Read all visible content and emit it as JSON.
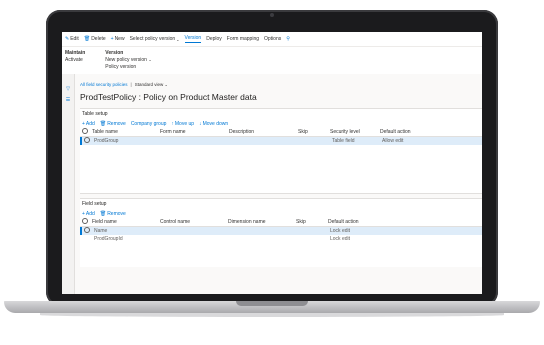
{
  "toolbar": {
    "items": [
      {
        "label": "Edit",
        "icon": "pencil-icon"
      },
      {
        "label": "Delete",
        "icon": "trash-icon"
      },
      {
        "label": "New",
        "icon": "plus-icon"
      },
      {
        "label": "Select policy version",
        "icon": "chevron-down-icon"
      },
      {
        "label": "Version"
      },
      {
        "label": "Deploy"
      },
      {
        "label": "Form mapping"
      },
      {
        "label": "Options"
      }
    ],
    "active_tab": "Version",
    "search_icon": "search-icon"
  },
  "ribbon": {
    "maintain": {
      "header": "Maintain",
      "items": [
        "Activate"
      ]
    },
    "version": {
      "header": "Version",
      "items": [
        "New policy version",
        "Policy version"
      ]
    }
  },
  "leftrail": {
    "icons": [
      "filter-icon",
      "list-icon"
    ]
  },
  "breadcrumb": {
    "link": "All field security policies",
    "separator": "|",
    "view": "Standard view"
  },
  "page_title": "ProdTestPolicy : Policy on Product Master data",
  "table_setup": {
    "title": "Table setup",
    "actions": [
      "Add",
      "Remove",
      "Company group",
      "Move up",
      "Move down"
    ],
    "columns": [
      "Table name",
      "Form name",
      "Description",
      "Skip",
      "Security level",
      "Default action"
    ],
    "rows": [
      {
        "table_name": "ProdGroup",
        "form_name": "",
        "description": "",
        "skip": "",
        "security_level": "Table field",
        "default_action": "Allow edit",
        "selected": true
      }
    ]
  },
  "field_setup": {
    "title": "Field setup",
    "actions": [
      "Add",
      "Remove"
    ],
    "columns": [
      "Field name",
      "Control name",
      "Dimension name",
      "Skip",
      "Default action"
    ],
    "rows": [
      {
        "field_name": "Name",
        "control_name": "",
        "dimension_name": "",
        "skip": "",
        "default_action": "Lock edit",
        "selected": true
      },
      {
        "field_name": "ProdGroupId",
        "control_name": "",
        "dimension_name": "",
        "skip": "",
        "default_action": "Lock edit",
        "selected": false
      }
    ]
  },
  "colors": {
    "accent": "#0078d4",
    "selected_row": "#deecf9",
    "laptop_bezel": "#1b1b1d"
  }
}
